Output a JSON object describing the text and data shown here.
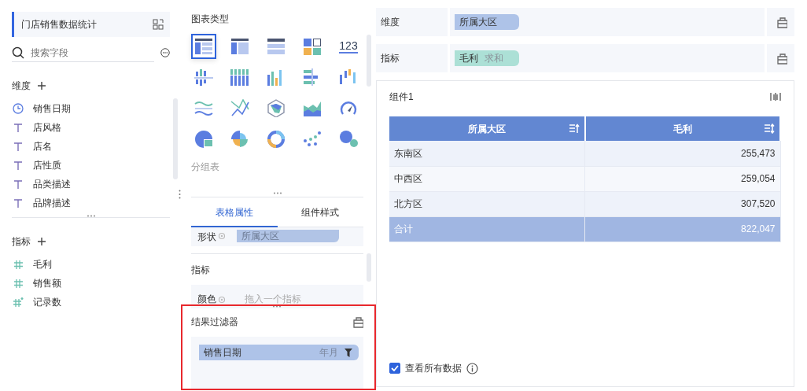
{
  "dataset": {
    "title": "门店销售数据统计"
  },
  "field_search": {
    "placeholder": "搜索字段"
  },
  "dimension_section": {
    "title": "维度"
  },
  "dimension_fields": [
    {
      "label": "销售日期",
      "kind": "date"
    },
    {
      "label": "店风格",
      "kind": "text"
    },
    {
      "label": "店名",
      "kind": "text"
    },
    {
      "label": "店性质",
      "kind": "text"
    },
    {
      "label": "品类描述",
      "kind": "text"
    },
    {
      "label": "品牌描述",
      "kind": "text"
    }
  ],
  "measure_section": {
    "title": "指标"
  },
  "measure_fields": [
    {
      "label": "毛利",
      "kind": "number"
    },
    {
      "label": "销售额",
      "kind": "number"
    },
    {
      "label": "记录数",
      "kind": "count"
    }
  ],
  "chart_type_section": {
    "title": "图表类型"
  },
  "chart_types": [
    {
      "kind": "group-table",
      "selected": true
    },
    {
      "kind": "cross-table",
      "selected": false
    },
    {
      "kind": "detail-table",
      "selected": false
    },
    {
      "kind": "card",
      "selected": false
    },
    {
      "kind": "number",
      "label": "123",
      "selected": false
    },
    {
      "kind": "split-bar",
      "selected": false
    },
    {
      "kind": "stacked-bar",
      "selected": false
    },
    {
      "kind": "bar",
      "selected": false
    },
    {
      "kind": "hbar",
      "selected": false
    },
    {
      "kind": "range-bar",
      "selected": false
    },
    {
      "kind": "wave",
      "selected": false
    },
    {
      "kind": "cross-line",
      "selected": false
    },
    {
      "kind": "radar",
      "selected": false
    },
    {
      "kind": "area",
      "selected": false
    },
    {
      "kind": "gauge",
      "selected": false
    },
    {
      "kind": "pie",
      "selected": false
    },
    {
      "kind": "rose",
      "selected": false
    },
    {
      "kind": "ring",
      "selected": false
    },
    {
      "kind": "scatter",
      "selected": false
    },
    {
      "kind": "bubble",
      "selected": false
    }
  ],
  "chart_type_name": "分组表",
  "property_tabs": [
    {
      "label": "表格属性",
      "selected": true
    },
    {
      "label": "组件样式",
      "selected": false
    }
  ],
  "shape_row": {
    "label": "形状",
    "value": "所属大区"
  },
  "measure_props": {
    "title": "指标"
  },
  "color_row": {
    "label": "颜色",
    "placeholder": "拖入一个指标"
  },
  "result_filter": {
    "title": "结果过滤器",
    "pill": {
      "label": "销售日期",
      "granularity": "年月"
    }
  },
  "dimension_bar": {
    "label": "维度",
    "pills": [
      {
        "label": "所属大区"
      }
    ]
  },
  "measure_bar": {
    "label": "指标",
    "pills": [
      {
        "label": "毛利",
        "aggregation": "求和"
      }
    ]
  },
  "widget": {
    "title": "组件1",
    "table": {
      "columns": [
        {
          "label": "所属大区"
        },
        {
          "label": "毛利"
        }
      ],
      "rows": [
        [
          "东南区",
          "255,473"
        ],
        [
          "中西区",
          "259,054"
        ],
        [
          "北方区",
          "307,520"
        ]
      ],
      "total": [
        "合计",
        "822,047"
      ]
    },
    "show_all": {
      "label": "查看所有数据",
      "checked": true
    }
  }
}
